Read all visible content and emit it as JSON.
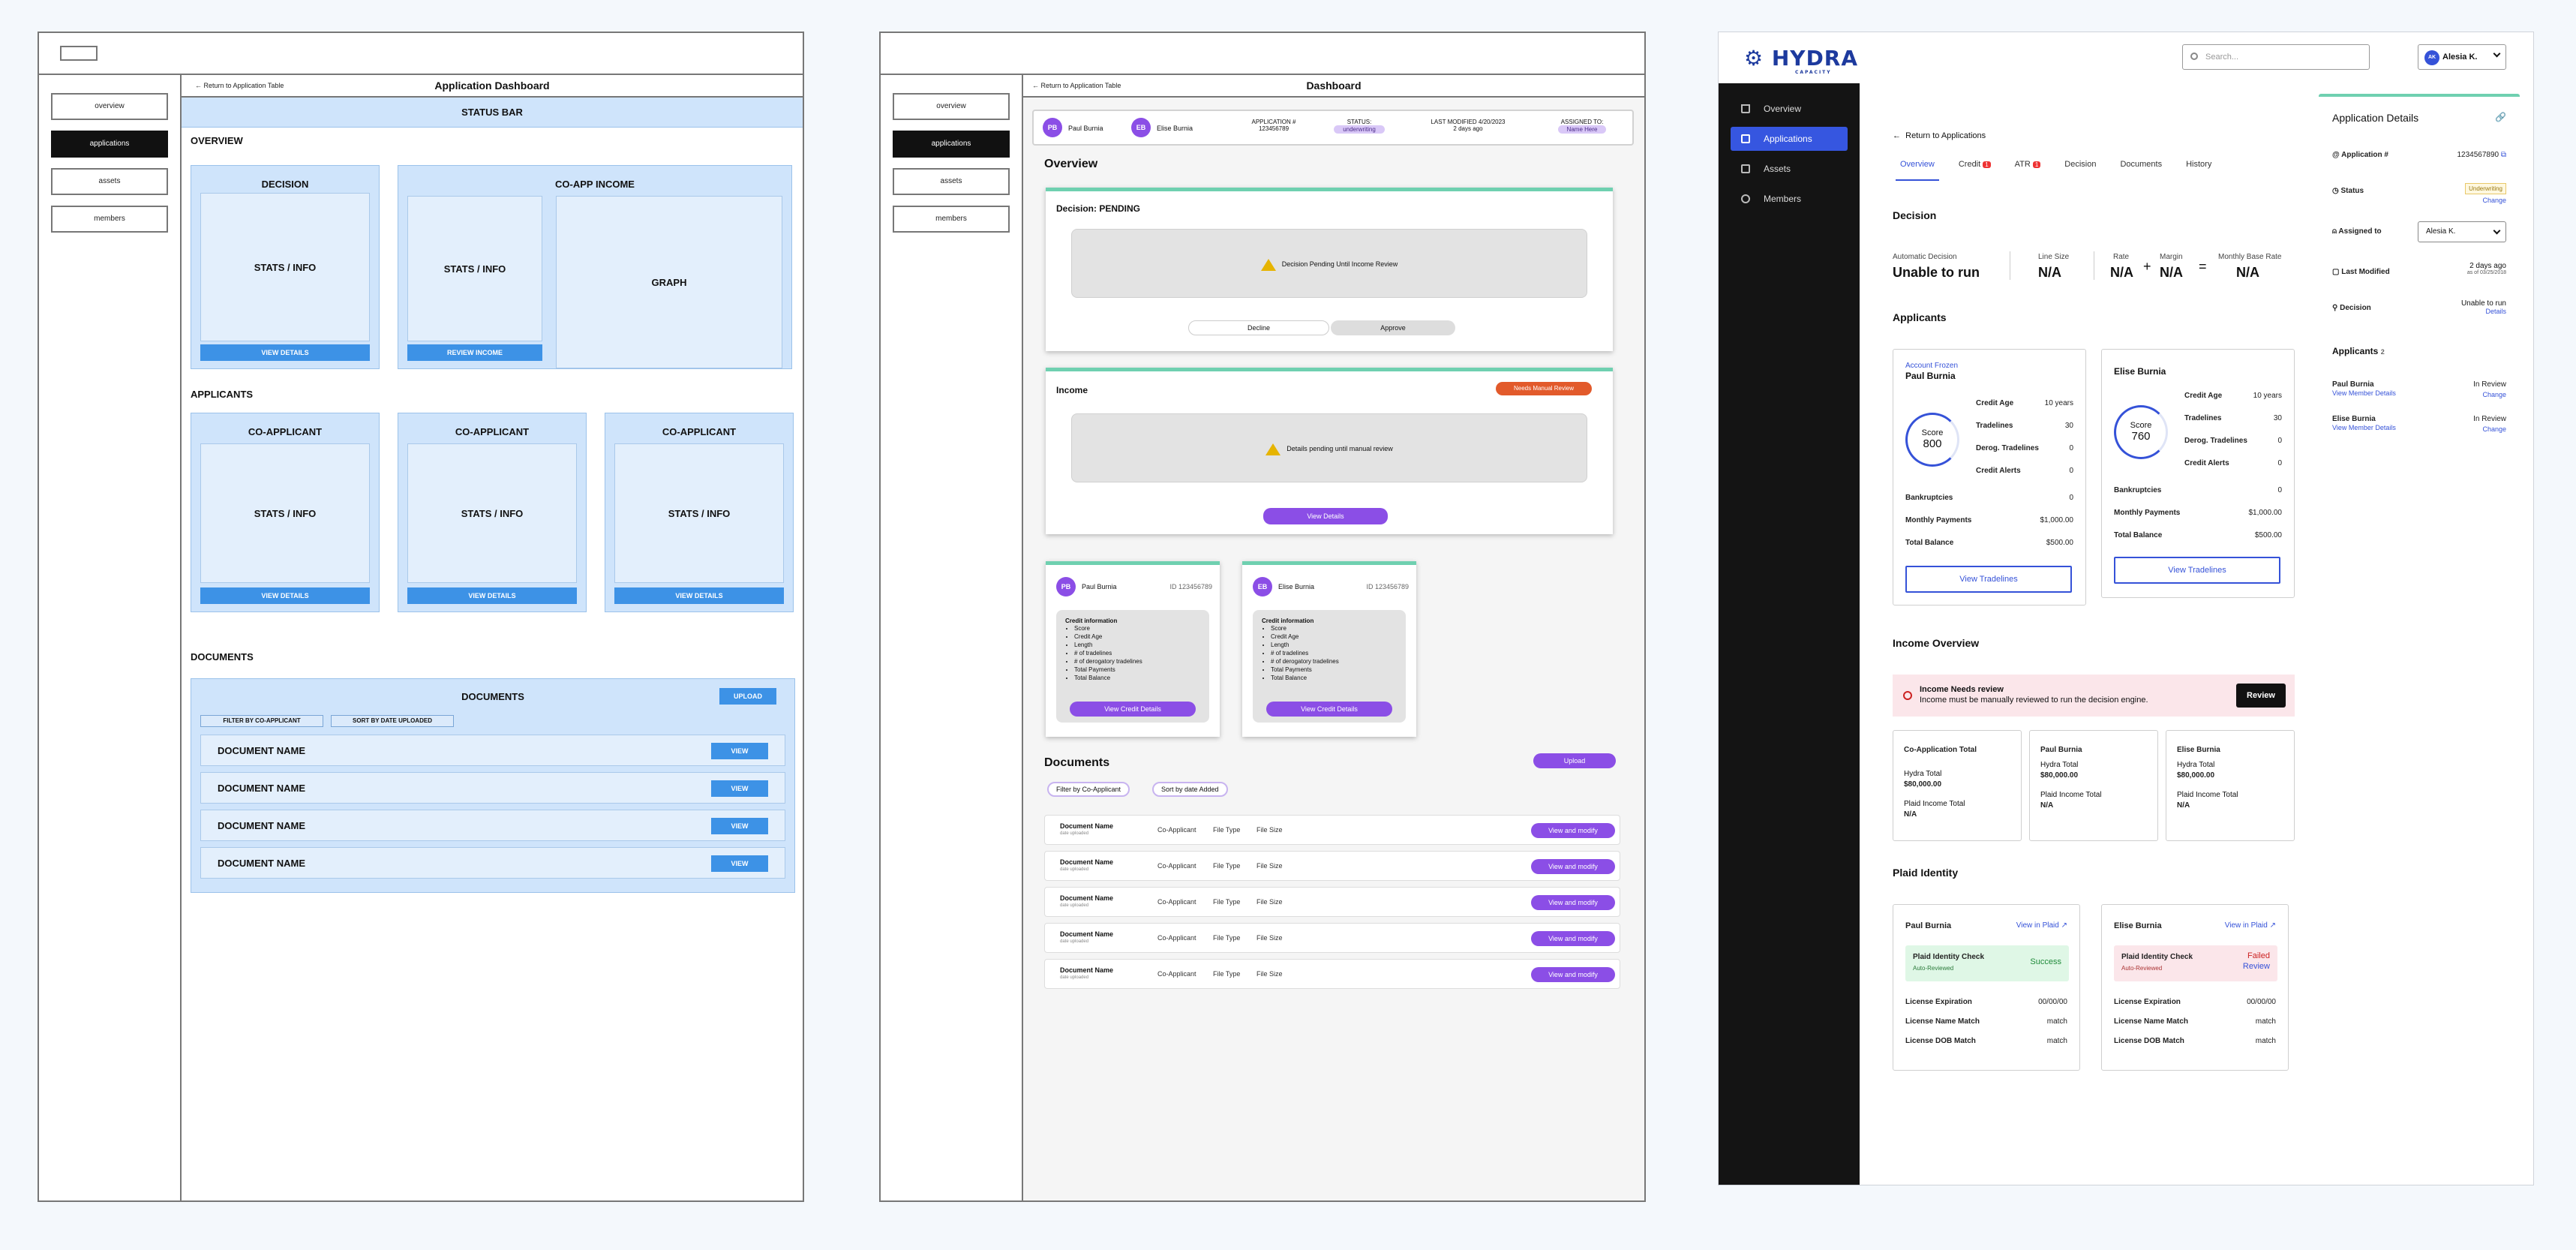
{
  "wf1": {
    "nav": [
      "overview",
      "applications",
      "assets",
      "members"
    ],
    "back": "← Return to Application Table",
    "title": "Application Dashboard",
    "status_bar": "STATUS BAR",
    "overview_label": "OVERVIEW",
    "decision": {
      "title": "DECISION",
      "stats": "STATS / INFO",
      "button": "VIEW DETAILS"
    },
    "coapp_income": {
      "title": "CO-APP INCOME",
      "stats": "STATS / INFO",
      "graph": "GRAPH",
      "button": "REVIEW INCOME"
    },
    "applicants_label": "APPLICANTS",
    "applicants": [
      {
        "title": "CO-APPLICANT",
        "stats": "STATS / INFO",
        "button": "VIEW DETAILS"
      },
      {
        "title": "CO-APPLICANT",
        "stats": "STATS / INFO",
        "button": "VIEW DETAILS"
      },
      {
        "title": "CO-APPLICANT",
        "stats": "STATS / INFO",
        "button": "VIEW DETAILS"
      }
    ],
    "documents_label": "DOCUMENTS",
    "documents": {
      "title": "DOCUMENTS",
      "upload": "UPLOAD",
      "filter": "FILTER BY CO-APPLICANT",
      "sort": "SORT BY DATE UPLOADED",
      "rows": [
        "DOCUMENT NAME",
        "DOCUMENT NAME",
        "DOCUMENT NAME",
        "DOCUMENT NAME"
      ],
      "view": "VIEW"
    }
  },
  "wf2": {
    "nav": [
      "overview",
      "applications",
      "assets",
      "members"
    ],
    "back": "← Return to Application Table",
    "title": "Dashboard",
    "strip": {
      "a1_initials": "PB",
      "a1_name": "Paul Burnia",
      "a2_initials": "EB",
      "a2_name": "Elise Burnia",
      "app_label": "APPLICATION #",
      "app_value": "123456789",
      "status_label": "STATUS:",
      "status_value": "underwriting",
      "modified_label": "LAST MODIFIED 4/20/2023",
      "modified_value": "2 days ago",
      "assigned_label": "ASSIGNED TO:",
      "assigned_value": "Name Here"
    },
    "overview_label": "Overview",
    "decision": {
      "title": "Decision: PENDING",
      "msg": "Decision Pending Until Income Review",
      "decline": "Decline",
      "approve": "Approve"
    },
    "income": {
      "title": "Income",
      "badge": "Needs Manual Review",
      "msg": "Details pending until manual review",
      "button": "View Details"
    },
    "cards": [
      {
        "initials": "PB",
        "name": "Paul Burnia",
        "id": "ID 123456789"
      },
      {
        "initials": "EB",
        "name": "Elise Burnia",
        "id": "ID 123456789"
      }
    ],
    "credit_heading": "Credit information",
    "credit_items": [
      "Score",
      "Credit Age",
      "Length",
      "# of tradelines",
      "# of derogatory tradelines",
      "Total Payments",
      "Total Balance"
    ],
    "credit_button": "View Credit Details",
    "documents_label": "Documents",
    "upload": "Upload",
    "filter": "Filter by Co-Applicant",
    "sort": "Sort by date Added",
    "doc_rows": [
      {
        "name": "Document Name",
        "sub": "date uploaded",
        "coapp": "Co-Applicant",
        "type": "File Type",
        "size": "File Size"
      },
      {
        "name": "Document Name",
        "sub": "date uploaded",
        "coapp": "Co-Applicant",
        "type": "File Type",
        "size": "File Size"
      },
      {
        "name": "Document Name",
        "sub": "date uploaded",
        "coapp": "Co-Applicant",
        "type": "File Type",
        "size": "File Size"
      },
      {
        "name": "Document Name",
        "sub": "date uploaded",
        "coapp": "Co-Applicant",
        "type": "File Type",
        "size": "File Size"
      },
      {
        "name": "Document Name",
        "sub": "date uploaded",
        "coapp": "Co-Applicant",
        "type": "File Type",
        "size": "File Size"
      }
    ],
    "doc_button": "View and modify"
  },
  "hifi": {
    "brand": "HYDRA",
    "brand_sub": "CAPACITY",
    "search_placeholder": "Search...",
    "user_initials": "AK",
    "user_name": "Alesia K.",
    "nav": [
      "Overview",
      "Applications",
      "Assets",
      "Members"
    ],
    "back": "Return to Applications",
    "tabs": [
      {
        "label": "Overview",
        "badge": ""
      },
      {
        "label": "Credit",
        "badge": "1"
      },
      {
        "label": "ATR",
        "badge": "1"
      },
      {
        "label": "Decision",
        "badge": ""
      },
      {
        "label": "Documents",
        "badge": ""
      },
      {
        "label": "History",
        "badge": ""
      }
    ],
    "decision": {
      "title": "Decision",
      "auto_label": "Automatic Decision",
      "auto_value": "Unable to run",
      "line_label": "Line Size",
      "line_value": "N/A",
      "rate_label": "Rate",
      "rate_value": "N/A",
      "margin_label": "Margin",
      "margin_value": "N/A",
      "mbr_label": "Monthly Base Rate",
      "mbr_value": "N/A",
      "plus": "+",
      "equals": "="
    },
    "applicants_title": "Applicants",
    "applicants": [
      {
        "flag": "Account Frozen",
        "name": "Paul Burnia",
        "score_label": "Score",
        "score": "800",
        "rows": [
          [
            "Credit Age",
            "10 years"
          ],
          [
            "Tradelines",
            "30"
          ],
          [
            "Derog. Tradelines",
            "0"
          ],
          [
            "Credit Alerts",
            "0"
          ]
        ],
        "rows2": [
          [
            "Bankruptcies",
            "0"
          ],
          [
            "Monthly Payments",
            "$1,000.00"
          ],
          [
            "Total Balance",
            "$500.00"
          ]
        ],
        "button": "View Tradelines"
      },
      {
        "flag": "",
        "name": "Elise Burnia",
        "score_label": "Score",
        "score": "760",
        "rows": [
          [
            "Credit Age",
            "10 years"
          ],
          [
            "Tradelines",
            "30"
          ],
          [
            "Derog. Tradelines",
            "0"
          ],
          [
            "Credit Alerts",
            "0"
          ]
        ],
        "rows2": [
          [
            "Bankruptcies",
            "0"
          ],
          [
            "Monthly Payments",
            "$1,000.00"
          ],
          [
            "Total Balance",
            "$500.00"
          ]
        ],
        "button": "View Tradelines"
      }
    ],
    "income": {
      "title": "Income Overview",
      "alert_title": "Income Needs review",
      "alert_text": "Income must be manually reviewed to run the decision engine.",
      "review": "Review",
      "cards": [
        {
          "title": "Co-Application Total",
          "h_label": "Hydra Total",
          "h_value": "$80,000.00",
          "p_label": "Plaid Income Total",
          "p_value": "N/A"
        },
        {
          "title": "Paul Burnia",
          "h_label": "Hydra Total",
          "h_value": "$80,000.00",
          "p_label": "Plaid Income Total",
          "p_value": "N/A"
        },
        {
          "title": "Elise Burnia",
          "h_label": "Hydra Total",
          "h_value": "$80,000.00",
          "p_label": "Plaid Income Total",
          "p_value": "N/A"
        }
      ]
    },
    "plaid": {
      "title": "Plaid Identity",
      "cards": [
        {
          "name": "Paul Burnia",
          "link": "View in Plaid",
          "check": "Plaid Identity Check",
          "sub": "Auto-Reviewed",
          "result": "Success",
          "result2": "",
          "rows": [
            [
              "License Expiration",
              "00/00/00"
            ],
            [
              "License Name Match",
              "match"
            ],
            [
              "License DOB Match",
              "match"
            ]
          ]
        },
        {
          "name": "Elise Burnia",
          "link": "View in Plaid",
          "check": "Plaid Identity Check",
          "sub": "Auto-Reviewed",
          "result": "Failed",
          "result2": "Review",
          "rows": [
            [
              "License Expiration",
              "00/00/00"
            ],
            [
              "License Name Match",
              "match"
            ],
            [
              "License DOB Match",
              "match"
            ]
          ]
        }
      ]
    },
    "details": {
      "title": "Application Details",
      "app_label": "Application #",
      "app_value": "1234567890",
      "status_label": "Status",
      "status_value": "Underwriting",
      "status_change": "Change",
      "assigned_label": "Assigned to",
      "assigned_value": "Alesia K.",
      "modified_label": "Last Modified",
      "modified_value": "2 days ago",
      "modified_sub": "as of 03/25/2018",
      "decision_label": "Decision",
      "decision_value": "Unable to run",
      "decision_link": "Details",
      "applicants_label": "Applicants",
      "applicants_count": "2",
      "applicants": [
        {
          "name": "Paul Burnia",
          "link": "View Member Details",
          "status": "In Review",
          "change": "Change"
        },
        {
          "name": "Elise Burnia",
          "link": "View Member Details",
          "status": "In Review",
          "change": "Change"
        }
      ]
    }
  }
}
